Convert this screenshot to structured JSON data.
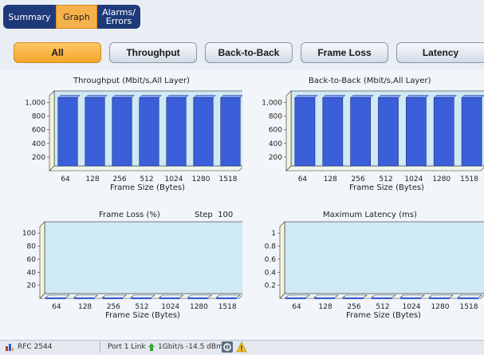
{
  "tabs": [
    {
      "label": "Summary",
      "active": false
    },
    {
      "label": "Graph",
      "active": true
    },
    {
      "label": "Alarms/ Errors",
      "active": false
    }
  ],
  "filters": [
    {
      "label": "All",
      "active": true
    },
    {
      "label": "Throughput",
      "active": false
    },
    {
      "label": "Back-to-Back",
      "active": false
    },
    {
      "label": "Frame Loss",
      "active": false
    },
    {
      "label": "Latency",
      "active": false
    }
  ],
  "colors": {
    "bar": "#3a5fd8",
    "bar_top": "#7f9bff",
    "plot_bg": "#cfe9f5",
    "active": "#f4a52c",
    "tab_dark": "#1f3a7a"
  },
  "step": {
    "label": "Step",
    "value": "100"
  },
  "chart_data": [
    {
      "type": "bar",
      "title": "Throughput (Mbit/s,All Layer)",
      "xlabel": "Frame Size (Bytes)",
      "ylabel": "",
      "categories": [
        "64",
        "128",
        "256",
        "512",
        "1024",
        "1280",
        "1518"
      ],
      "values": [
        1000,
        1000,
        1000,
        1000,
        1000,
        1000,
        1000
      ],
      "ylim": [
        0,
        1100
      ],
      "yticks": [
        200,
        400,
        600,
        800,
        1000
      ],
      "ytick_labels": [
        "200",
        "400",
        "600",
        "800",
        "1,000"
      ]
    },
    {
      "type": "bar",
      "title": "Back-to-Back (Mbit/s,All Layer)",
      "xlabel": "Frame Size (Bytes)",
      "ylabel": "",
      "categories": [
        "64",
        "128",
        "256",
        "512",
        "1024",
        "1280",
        "1518"
      ],
      "values": [
        1000,
        1000,
        1000,
        1000,
        1000,
        1000,
        1000
      ],
      "ylim": [
        0,
        1100
      ],
      "yticks": [
        200,
        400,
        600,
        800,
        1000
      ],
      "ytick_labels": [
        "200",
        "400",
        "600",
        "800",
        "1,000"
      ]
    },
    {
      "type": "bar",
      "title": "Frame Loss (%)",
      "xlabel": "Frame Size (Bytes)",
      "ylabel": "",
      "categories": [
        "64",
        "128",
        "256",
        "512",
        "1024",
        "1280",
        "1518"
      ],
      "values": [
        0,
        0,
        0,
        0,
        0,
        0,
        0
      ],
      "ylim": [
        0,
        110
      ],
      "yticks": [
        20,
        40,
        60,
        80,
        100
      ],
      "ytick_labels": [
        "20",
        "40",
        "60",
        "80",
        "100"
      ]
    },
    {
      "type": "bar",
      "title": "Maximum Latency (ms)",
      "xlabel": "Frame Size (Bytes)",
      "ylabel": "",
      "categories": [
        "64",
        "128",
        "256",
        "512",
        "1024",
        "1280",
        "1518"
      ],
      "values": [
        0,
        0,
        0,
        0,
        0,
        0,
        0
      ],
      "ylim": [
        0,
        1.1
      ],
      "yticks": [
        0.2,
        0.4,
        0.6,
        0.8,
        1
      ],
      "ytick_labels": [
        "0.2",
        "0.4",
        "0.6",
        "0.8",
        "1"
      ]
    }
  ],
  "status": {
    "test_name": "RFC 2544",
    "port_link": "Port 1 Link",
    "rate": "1Gbit/s -14.5 dBm"
  }
}
